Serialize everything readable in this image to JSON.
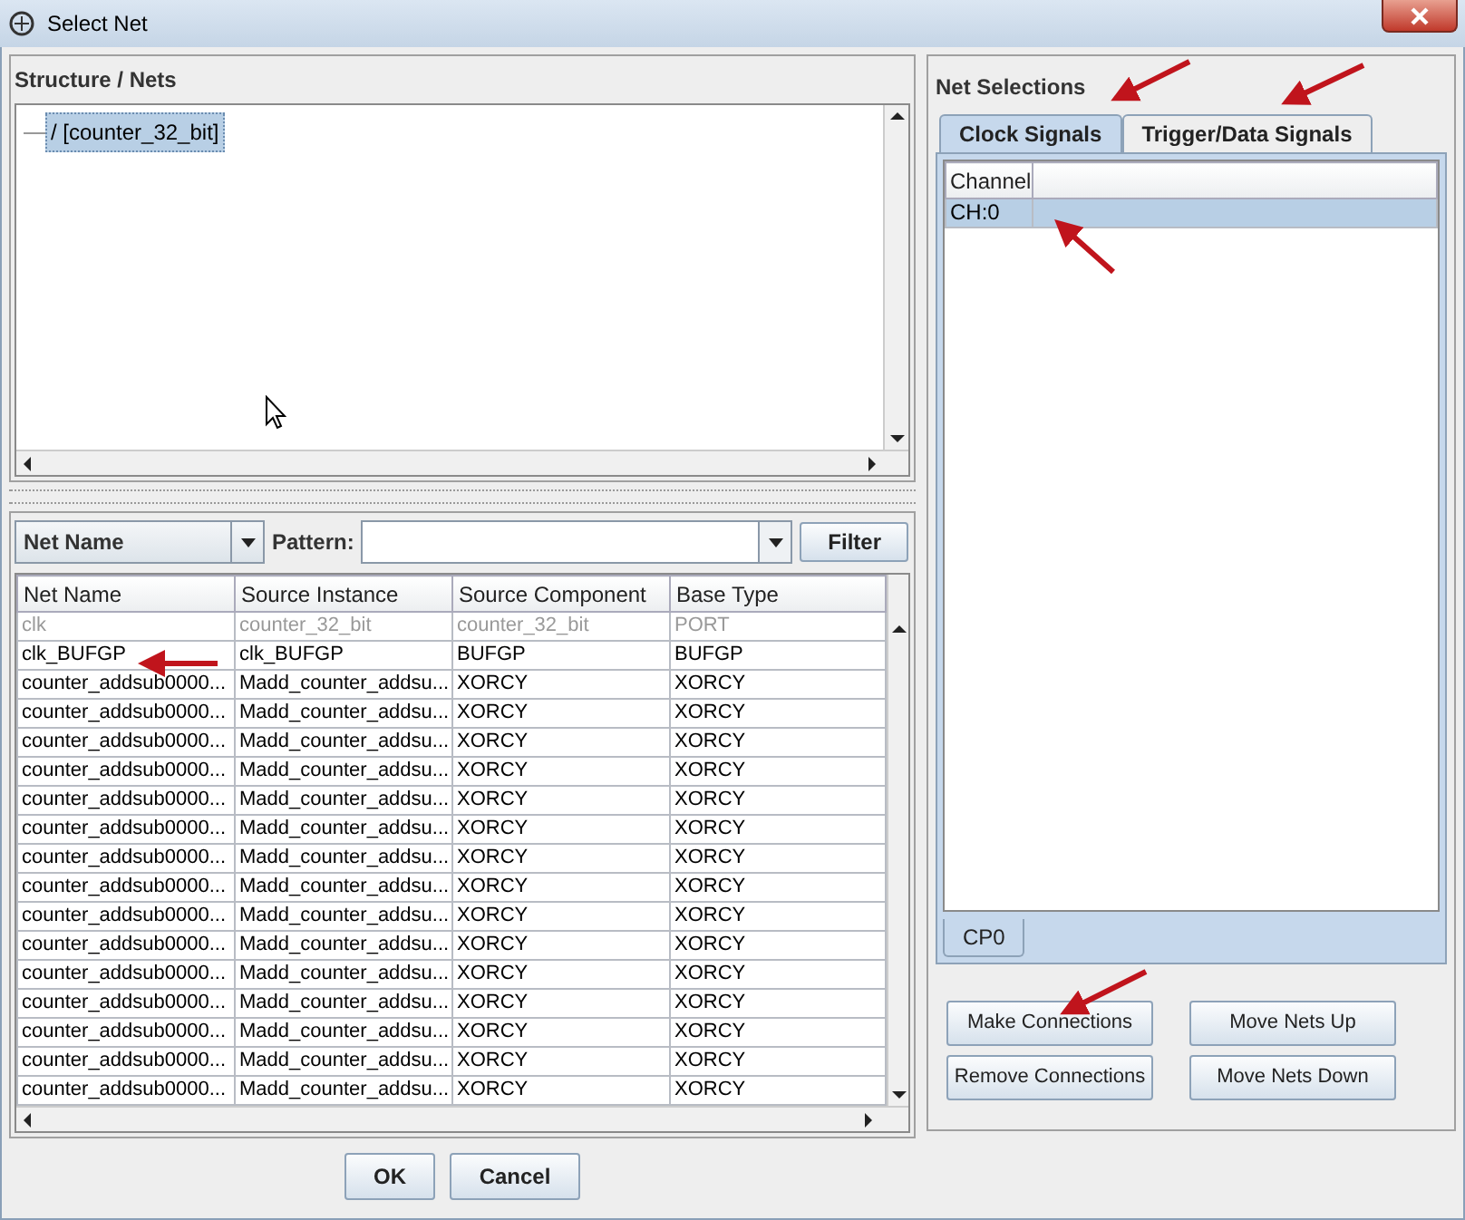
{
  "window": {
    "title": "Select Net"
  },
  "structure": {
    "title": "Structure / Nets",
    "tree": [
      {
        "label": "/ [counter_32_bit]",
        "selected": true
      }
    ]
  },
  "filter": {
    "field_combo": "Net Name",
    "pattern_label": "Pattern:",
    "filter_button": "Filter"
  },
  "nets_table": {
    "columns": [
      "Net Name",
      "Source Instance",
      "Source Component",
      "Base Type"
    ],
    "rows": [
      {
        "cells": [
          "clk",
          "counter_32_bit",
          "counter_32_bit",
          "PORT"
        ],
        "disabled": true
      },
      {
        "cells": [
          "clk_BUFGP",
          "clk_BUFGP",
          "BUFGP",
          "BUFGP"
        ],
        "disabled": false
      },
      {
        "cells": [
          "counter_addsub0000...",
          "Madd_counter_addsu...",
          "XORCY",
          "XORCY"
        ],
        "disabled": false
      },
      {
        "cells": [
          "counter_addsub0000...",
          "Madd_counter_addsu...",
          "XORCY",
          "XORCY"
        ],
        "disabled": false
      },
      {
        "cells": [
          "counter_addsub0000...",
          "Madd_counter_addsu...",
          "XORCY",
          "XORCY"
        ],
        "disabled": false
      },
      {
        "cells": [
          "counter_addsub0000...",
          "Madd_counter_addsu...",
          "XORCY",
          "XORCY"
        ],
        "disabled": false
      },
      {
        "cells": [
          "counter_addsub0000...",
          "Madd_counter_addsu...",
          "XORCY",
          "XORCY"
        ],
        "disabled": false
      },
      {
        "cells": [
          "counter_addsub0000...",
          "Madd_counter_addsu...",
          "XORCY",
          "XORCY"
        ],
        "disabled": false
      },
      {
        "cells": [
          "counter_addsub0000...",
          "Madd_counter_addsu...",
          "XORCY",
          "XORCY"
        ],
        "disabled": false
      },
      {
        "cells": [
          "counter_addsub0000...",
          "Madd_counter_addsu...",
          "XORCY",
          "XORCY"
        ],
        "disabled": false
      },
      {
        "cells": [
          "counter_addsub0000...",
          "Madd_counter_addsu...",
          "XORCY",
          "XORCY"
        ],
        "disabled": false
      },
      {
        "cells": [
          "counter_addsub0000...",
          "Madd_counter_addsu...",
          "XORCY",
          "XORCY"
        ],
        "disabled": false
      },
      {
        "cells": [
          "counter_addsub0000...",
          "Madd_counter_addsu...",
          "XORCY",
          "XORCY"
        ],
        "disabled": false
      },
      {
        "cells": [
          "counter_addsub0000...",
          "Madd_counter_addsu...",
          "XORCY",
          "XORCY"
        ],
        "disabled": false
      },
      {
        "cells": [
          "counter_addsub0000...",
          "Madd_counter_addsu...",
          "XORCY",
          "XORCY"
        ],
        "disabled": false
      },
      {
        "cells": [
          "counter_addsub0000...",
          "Madd_counter_addsu...",
          "XORCY",
          "XORCY"
        ],
        "disabled": false
      },
      {
        "cells": [
          "counter_addsub0000...",
          "Madd_counter_addsu...",
          "XORCY",
          "XORCY"
        ],
        "disabled": false
      }
    ]
  },
  "dialog_buttons": [
    "OK",
    "Cancel"
  ],
  "net_selections": {
    "title": "Net Selections",
    "tabs": [
      {
        "label": "Clock Signals",
        "selected": true
      },
      {
        "label": "Trigger/Data Signals",
        "selected": false
      }
    ],
    "channel_table": {
      "columns": [
        "Channel"
      ],
      "rows": [
        {
          "cells": [
            "CH:0"
          ],
          "selected": true
        }
      ]
    },
    "bottom_tabs": [
      {
        "label": "CP0",
        "selected": true
      }
    ],
    "buttons": [
      "Make Connections",
      "Move Nets Up",
      "Remove Connections",
      "Move Nets Down"
    ]
  }
}
